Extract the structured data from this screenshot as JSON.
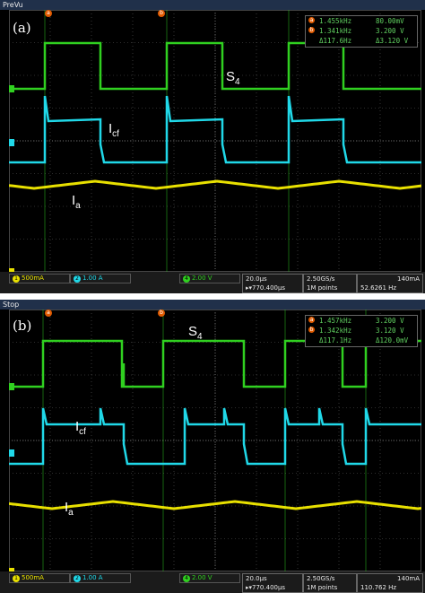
{
  "colors": {
    "ch1": "#e8e000",
    "ch2": "#20d8e8",
    "ch4": "#30d020",
    "grid": "#5a5a5a",
    "marker": "#e05a00"
  },
  "panels": [
    {
      "id": "a",
      "status": "PreVu",
      "label": "(a)",
      "labels": {
        "s": "S",
        "s_sub": "4",
        "i": "I",
        "i_sub": "cf",
        "ia": "I",
        "ia_sub": "a"
      },
      "markers": {
        "m1": "a",
        "m2": "b"
      },
      "measure": {
        "row1_a": "1.455kHz",
        "row1_b": "80.00mV",
        "row2_a": "1.341kHz",
        "row2_b": "3.200 V",
        "delta_a": "Δ117.6Hz",
        "delta_b": "Δ3.120 V"
      },
      "channels": [
        {
          "num": "1",
          "label": "500mA"
        },
        {
          "num": "2",
          "label": "1.00 A"
        },
        {
          "num": "4",
          "label": "2.00 V"
        }
      ],
      "timebase": "20.0µs",
      "delay": "▸▾770.400µs",
      "rate": "2.50GS/s",
      "points": "1M points",
      "trig_level": "140mA",
      "freq": "52.6261 Hz"
    },
    {
      "id": "b",
      "status": "Stop",
      "label": "(b)",
      "labels": {
        "s": "S",
        "s_sub": "4",
        "i": "I",
        "i_sub": "cf",
        "ia": "I",
        "ia_sub": "a"
      },
      "markers": {
        "m1": "a",
        "m2": "b"
      },
      "measure": {
        "row1_a": "1.457kHz",
        "row1_b": "3.200 V",
        "row2_a": "1.342kHz",
        "row2_b": "3.120 V",
        "delta_a": "Δ117.1Hz",
        "delta_b": "Δ120.0mV"
      },
      "channels": [
        {
          "num": "1",
          "label": "500mA"
        },
        {
          "num": "2",
          "label": "1.00 A"
        },
        {
          "num": "4",
          "label": "2.00 V"
        }
      ],
      "timebase": "20.0µs",
      "delay": "▸▾770.400µs",
      "rate": "2.50GS/s",
      "points": "1M points",
      "trig_level": "140mA",
      "freq": "110.762 Hz"
    }
  ]
}
